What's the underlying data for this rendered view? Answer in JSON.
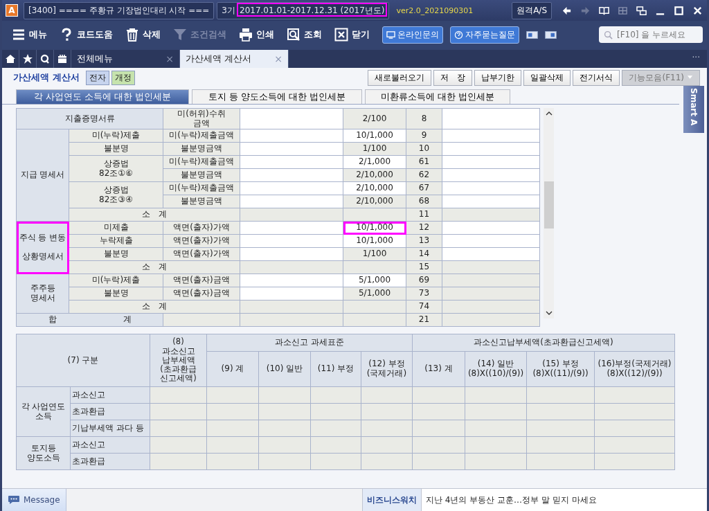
{
  "title_bar": {
    "app_letter": "A",
    "company": "[3400] ==== 주황규 기장법인대리 시작 ===",
    "term": "3기",
    "period": "2017.01.01-2017.12.31 (2017년도)",
    "period_highlighted": true,
    "version": "ver2.0_2021090301",
    "remote_button": "원격A/S"
  },
  "toolbar": [
    {
      "kind": "menu",
      "label": "메뉴",
      "disabled": false
    },
    {
      "kind": "help",
      "label": "코드도움",
      "disabled": false
    },
    {
      "kind": "delete",
      "label": "삭제",
      "disabled": false
    },
    {
      "kind": "filter",
      "label": "조건검색",
      "disabled": true
    },
    {
      "kind": "print",
      "label": "인쇄",
      "disabled": false
    },
    {
      "kind": "lookup",
      "label": "조회",
      "disabled": false
    },
    {
      "kind": "close",
      "label": "닫기",
      "disabled": false
    }
  ],
  "quick_buttons": [
    {
      "kind": "chat",
      "label": "온라인문의"
    },
    {
      "kind": "faq",
      "label": "자주묻는질문"
    }
  ],
  "search": {
    "placeholder": "[F10] 을 누르세요"
  },
  "tabs": [
    {
      "label": "전체메뉴",
      "selected": false,
      "close": "×"
    },
    {
      "label": "가산세액 계산서",
      "selected": true,
      "close": "×"
    }
  ],
  "tabs_more": "···",
  "form": {
    "title": "가산세액 계산서",
    "badges": [
      {
        "label": "전자",
        "color": "#c7d4ee"
      },
      {
        "label": "개정",
        "color": "#c6e3ad"
      }
    ]
  },
  "actions": [
    {
      "label": "새로불러오기",
      "disabled": false,
      "dropdown": false
    },
    {
      "label": "저　장",
      "disabled": false,
      "dropdown": false
    },
    {
      "label": "납부기한",
      "disabled": false,
      "dropdown": false
    },
    {
      "label": "일괄삭제",
      "disabled": false,
      "dropdown": false
    },
    {
      "label": "전기서식",
      "disabled": false,
      "dropdown": false
    },
    {
      "label": "기능모음(F11)",
      "disabled": true,
      "dropdown": true
    }
  ],
  "section_tabs": [
    {
      "label": "각 사업연도 소득에 대한 법인세분",
      "selected": true
    },
    {
      "label": "토지 등 양도소득에 대한 법인세분",
      "selected": false
    },
    {
      "label": "미환류소득에 대한 법인세분",
      "selected": false
    }
  ],
  "side_tab": "Smart A",
  "penalty_table": {
    "groups": [
      {
        "kind": "single",
        "label": "지출증명서류",
        "item": "미(허위)수취\n금액",
        "rate": "2/100",
        "rate_editable": false,
        "code": "8",
        "note_editable": true
      },
      {
        "kind": "group",
        "label": "지급 명세서",
        "highlighted": false,
        "subgroups": [
          {
            "label": "미(누락)제출",
            "rows": [
              {
                "item": "미(누락)제출금액",
                "rate": "10/1,000",
                "rate_editable": true,
                "rate_highlighted": false,
                "code": "9",
                "note_editable": true
              }
            ]
          },
          {
            "label": "불분명",
            "rows": [
              {
                "item": "불분명금액",
                "rate": "1/100",
                "rate_editable": false,
                "rate_highlighted": false,
                "code": "10",
                "note_editable": true
              }
            ]
          },
          {
            "label": "상증법\n82조①⑥",
            "rows": [
              {
                "item": "미(누락)제출금액",
                "rate": "2/1,000",
                "rate_editable": true,
                "rate_highlighted": false,
                "code": "61",
                "note_editable": true
              },
              {
                "item": "불분명금액",
                "rate": "2/10,000",
                "rate_editable": false,
                "rate_highlighted": false,
                "code": "62",
                "note_editable": true
              }
            ]
          },
          {
            "label": "상증법\n82조③④",
            "rows": [
              {
                "item": "미(누락)제출금액",
                "rate": "2/10,000",
                "rate_editable": true,
                "rate_highlighted": false,
                "code": "67",
                "note_editable": true
              },
              {
                "item": "불분명금액",
                "rate": "2/10,000",
                "rate_editable": false,
                "rate_highlighted": false,
                "code": "68",
                "note_editable": true
              }
            ]
          }
        ],
        "subtotal": {
          "label": "소　계",
          "code": "11"
        }
      },
      {
        "kind": "group",
        "label": "주식 등 변동\n\n상황명세서",
        "highlighted": true,
        "subgroups": [
          {
            "label": "미제출",
            "rows": [
              {
                "item": "액면(출자)가액",
                "rate": "10/1,000",
                "rate_editable": true,
                "rate_highlighted": true,
                "code": "12",
                "note_editable": true
              }
            ]
          },
          {
            "label": "누락제출",
            "rows": [
              {
                "item": "액면(출자)가액",
                "rate": "10/1,000",
                "rate_editable": true,
                "rate_highlighted": false,
                "code": "13",
                "note_editable": true
              }
            ]
          },
          {
            "label": "불분명",
            "rows": [
              {
                "item": "액면(출자)가액",
                "rate": "1/100",
                "rate_editable": false,
                "rate_highlighted": false,
                "code": "14",
                "note_editable": true
              }
            ]
          }
        ],
        "subtotal": {
          "label": "소　계",
          "code": "15"
        }
      },
      {
        "kind": "group",
        "label": "주주등\n명세서",
        "highlighted": false,
        "subgroups": [
          {
            "label": "미(누락)제출",
            "rows": [
              {
                "item": "액면(출자)금액",
                "rate": "5/1,000",
                "rate_editable": true,
                "rate_highlighted": false,
                "code": "69",
                "note_editable": false
              }
            ]
          },
          {
            "label": "불분명",
            "rows": [
              {
                "item": "액면(출자)금액",
                "rate": "5/1,000",
                "rate_editable": false,
                "rate_highlighted": false,
                "code": "73",
                "note_editable": false
              }
            ]
          }
        ],
        "subtotal": {
          "label": "소　계",
          "code": "74"
        }
      },
      {
        "kind": "total",
        "label": "합　　　　　　　　계",
        "code": "21"
      }
    ]
  },
  "tax_table": {
    "category": "(7) 구분",
    "col8": "(8)\n과소신고\n납부세액\n(초과환급\n신고세액)",
    "group1": "과소신고 과세표준",
    "group1_cols": [
      "(9) 계",
      "(10) 일반",
      "(11) 부정",
      "(12) 부정\n(국제거래)"
    ],
    "group2": "과소신고납부세액(초과환급신고세액)",
    "group2_cols": [
      "(13) 계",
      "(14) 일반\n(8)X((10)/(9))",
      "(15) 부정\n(8)X((11)/(9))",
      "(16)부정(국제거래)\n(8)X((12)/(9))"
    ],
    "groups": [
      {
        "label": "각 사업연도\n소득",
        "rows": [
          "과소신고",
          "초과환급",
          "기납부세액 과다 등"
        ]
      },
      {
        "label": "토지등\n양도소득",
        "rows": [
          "과소신고",
          "초과환급"
        ]
      }
    ]
  },
  "status_bar": {
    "message": "Message",
    "news_source": "비즈니스워치",
    "headline": "지난 4년의 부동산 교훈…정부 말 믿지 마세요"
  }
}
